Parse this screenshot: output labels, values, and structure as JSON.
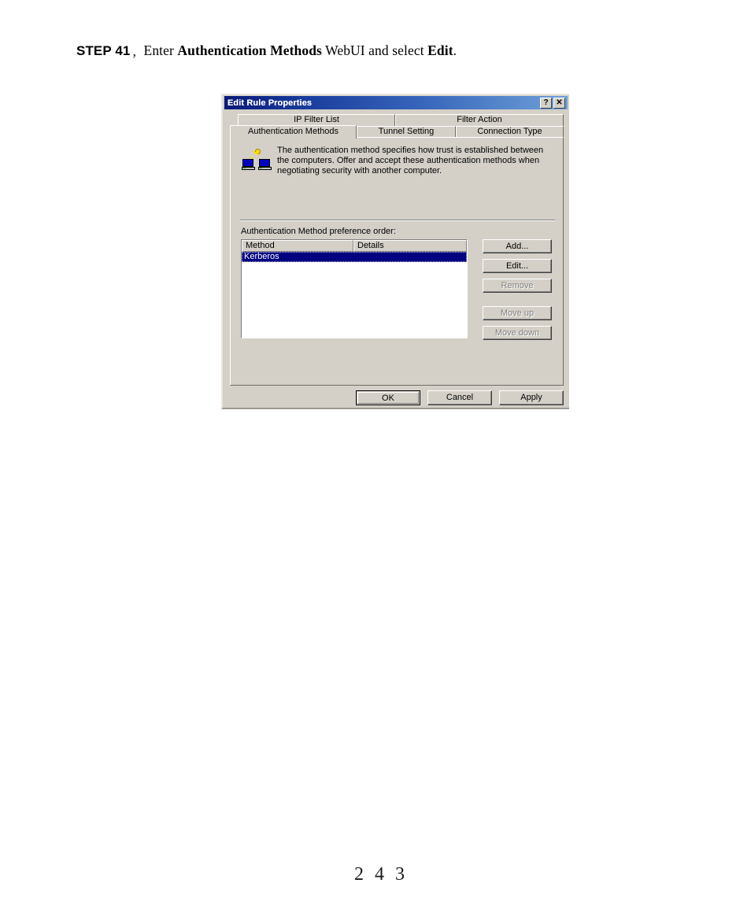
{
  "document": {
    "step_label": "STEP 41",
    "step_separator": "，",
    "step_text_1": "Enter ",
    "step_bold_1": "Authentication Methods",
    "step_text_2": " WebUI and select ",
    "step_bold_2": "Edit",
    "step_text_3": ".",
    "page_number": "2 4 3"
  },
  "dialog": {
    "title": "Edit Rule Properties",
    "titlebar_buttons": [
      {
        "name": "help-button",
        "glyph": "?"
      },
      {
        "name": "close-button",
        "glyph": "✕"
      }
    ],
    "tabs_row1": [
      {
        "label": "IP Filter List",
        "active": false
      },
      {
        "label": "Filter Action",
        "active": false
      }
    ],
    "tabs_row2": [
      {
        "label": "Authentication Methods",
        "active": true
      },
      {
        "label": "Tunnel Setting",
        "active": false
      },
      {
        "label": "Connection Type",
        "active": false
      }
    ],
    "description": "The authentication method specifies how trust is established between the computers. Offer and accept these authentication methods when negotiating security with another computer.",
    "description_icon": "two-computers-key-icon",
    "pref_label": "Authentication Method preference order:",
    "list": {
      "columns": [
        "Method",
        "Details"
      ],
      "rows": [
        {
          "method": "Kerberos",
          "details": "",
          "selected": true
        }
      ]
    },
    "side_buttons": [
      {
        "label": "Add...",
        "enabled": true
      },
      {
        "label": "Edit...",
        "enabled": true
      },
      {
        "label": "Remove",
        "enabled": false
      },
      {
        "label": "Move up",
        "enabled": false
      },
      {
        "label": "Move down",
        "enabled": false
      }
    ],
    "bottom_buttons": [
      {
        "label": "OK",
        "default": true
      },
      {
        "label": "Cancel",
        "default": false
      },
      {
        "label": "Apply",
        "default": false
      }
    ],
    "colors": {
      "face": "#d4d0c8",
      "titlebar_start": "#0a1a7a",
      "titlebar_end": "#6fa0d8",
      "selection": "#000080",
      "list_bg": "#ffffff",
      "disabled_text": "#808080"
    }
  }
}
